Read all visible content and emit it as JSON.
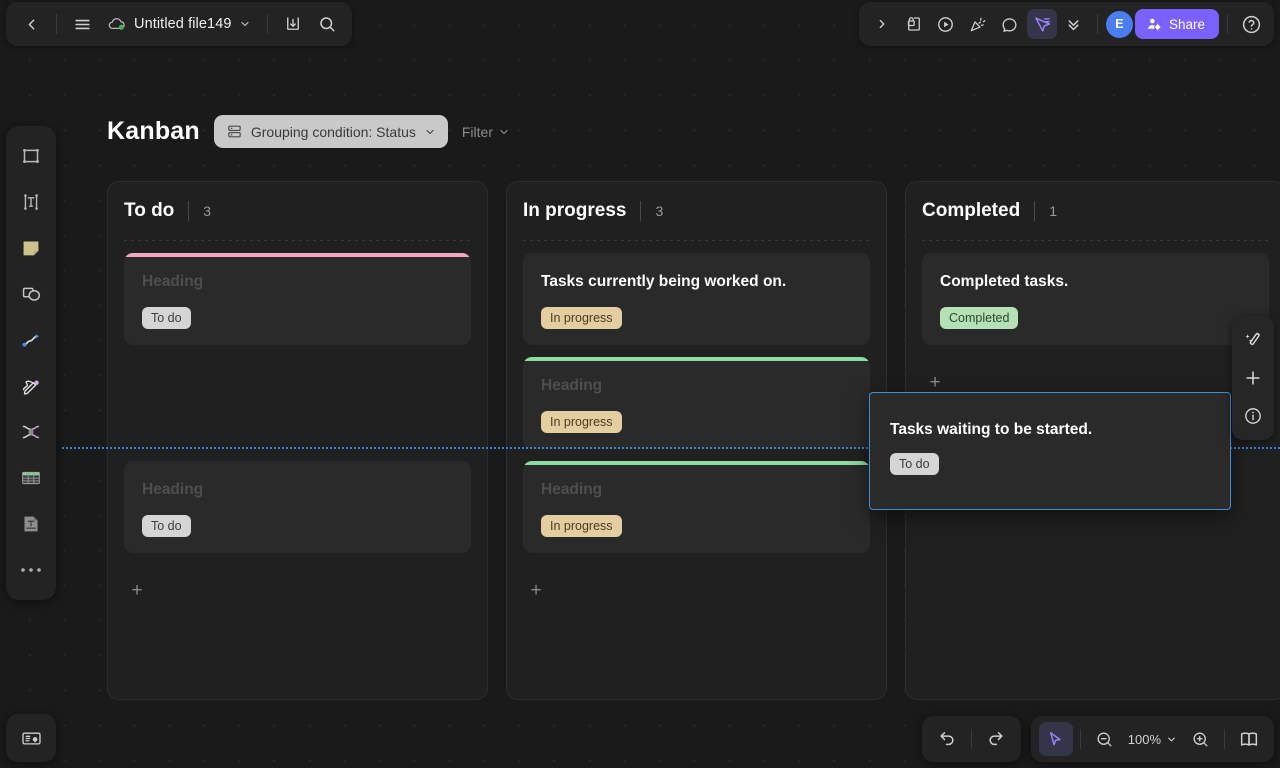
{
  "topbar": {
    "back_label": "‹",
    "menu_label": "menu",
    "file_name": "Untitled file149",
    "sync_status": "synced",
    "download_label": "download",
    "search_label": "search",
    "right_items": [
      {
        "name": "expand-toolbar",
        "icon": "chevron-right-icon"
      },
      {
        "name": "present-lock",
        "icon": "page-lock-icon"
      },
      {
        "name": "play",
        "icon": "play-circle-icon"
      },
      {
        "name": "celebrate",
        "icon": "confetti-icon"
      },
      {
        "name": "comment",
        "icon": "comment-bubble-icon"
      },
      {
        "name": "select-mode",
        "icon": "cursor-select-icon"
      },
      {
        "name": "collapse",
        "icon": "double-chevron-down-icon"
      }
    ],
    "avatar_initial": "E",
    "share_label": "Share",
    "help_label": "help"
  },
  "rail": {
    "tools": [
      {
        "name": "frame-tool",
        "icon": "frame-icon"
      },
      {
        "name": "text-tool",
        "icon": "text-box-icon"
      },
      {
        "name": "sticky-note-tool",
        "icon": "sticky-note-icon"
      },
      {
        "name": "shape-tool",
        "icon": "shapes-icon"
      },
      {
        "name": "connector-tool",
        "icon": "curve-connector-icon"
      },
      {
        "name": "pen-tool",
        "icon": "pen-draw-icon"
      },
      {
        "name": "mindmap-tool",
        "icon": "mindmap-icon"
      },
      {
        "name": "table-tool",
        "icon": "table-icon"
      },
      {
        "name": "document-tool",
        "icon": "document-text-icon"
      },
      {
        "name": "more-tools",
        "icon": "ellipsis-icon"
      }
    ],
    "minimap_label": "minimap"
  },
  "board": {
    "title": "Kanban",
    "grouping_label": "Grouping condition: Status",
    "filter_label": "Filter",
    "columns": [
      {
        "title": "To do",
        "count": "3",
        "add_label": "+",
        "cards": [
          {
            "title": "Heading",
            "placeholder": true,
            "tag": "To do",
            "tag_style": "todo",
            "accent": "pink"
          },
          {
            "title": "Heading",
            "placeholder": true,
            "tag": "To do",
            "tag_style": "todo",
            "accent": "none",
            "hidden": true
          },
          {
            "title": "Heading",
            "placeholder": true,
            "tag": "To do",
            "tag_style": "todo",
            "accent": "none"
          }
        ]
      },
      {
        "title": "In progress",
        "count": "3",
        "add_label": "+",
        "cards": [
          {
            "title": "Tasks currently being worked on.",
            "placeholder": false,
            "tag": "In progress",
            "tag_style": "prog",
            "accent": "none"
          },
          {
            "title": "Heading",
            "placeholder": true,
            "tag": "In progress",
            "tag_style": "prog",
            "accent": "green"
          },
          {
            "title": "Heading",
            "placeholder": true,
            "tag": "In progress",
            "tag_style": "prog",
            "accent": "green"
          }
        ]
      },
      {
        "title": "Completed",
        "count": "1",
        "add_label": "+",
        "cards": [
          {
            "title": "Completed tasks.",
            "placeholder": false,
            "tag": "Completed",
            "tag_style": "done",
            "accent": "none"
          }
        ]
      }
    ]
  },
  "drag": {
    "card_title": "Tasks waiting to be started.",
    "card_tag": "To do",
    "selection_color": "#3d8fd6",
    "guide_color": "#3d7fd0"
  },
  "right_panel": {
    "items": [
      {
        "name": "ai-magic-button",
        "icon": "magic-wand-icon"
      },
      {
        "name": "add-button",
        "icon": "plus-icon"
      },
      {
        "name": "info-button",
        "icon": "info-circle-icon"
      }
    ]
  },
  "bottom": {
    "undo_label": "undo",
    "redo_label": "redo",
    "cursor_label": "select",
    "zoom_out_label": "zoom out",
    "zoom_level": "100%",
    "zoom_in_label": "zoom in",
    "pages_label": "pages"
  },
  "colors": {
    "accent_purple": "#7b61ff",
    "avatar_blue": "#4a7ef0",
    "card_pink": "#efa8c0",
    "card_green": "#8ddba0",
    "tag_todo": "#d5d5d5",
    "tag_progress": "#e3cea0",
    "tag_completed": "#b6e0b6",
    "canvas_bg": "#1a1a1a"
  }
}
